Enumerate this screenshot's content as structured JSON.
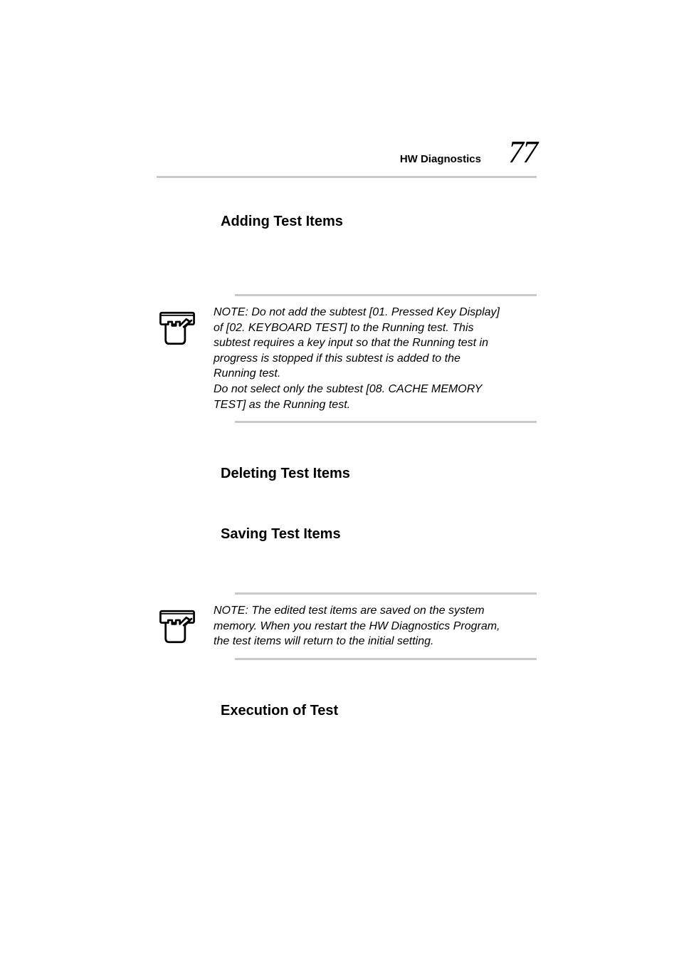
{
  "header": {
    "label": "HW Diagnostics",
    "page_number": "77"
  },
  "sections": {
    "adding": {
      "heading": "Adding Test Items"
    },
    "deleting": {
      "heading": "Deleting Test Items"
    },
    "saving": {
      "heading": "Saving Test Items"
    },
    "execution": {
      "heading": "Execution of Test"
    }
  },
  "notes": {
    "note1": {
      "text": "NOTE: Do not add the subtest [01. Pressed Key Display] of [02. KEYBOARD TEST] to the Running test. This subtest requires a key input so that the Running test in progress is stopped if this subtest is added to the Running test.\nDo not select only the subtest [08. CACHE MEMORY TEST] as the Running test."
    },
    "note2": {
      "text": "NOTE: The edited test items are saved on the system memory. When you restart the HW Diagnostics Program, the test items will return to the initial setting."
    }
  }
}
